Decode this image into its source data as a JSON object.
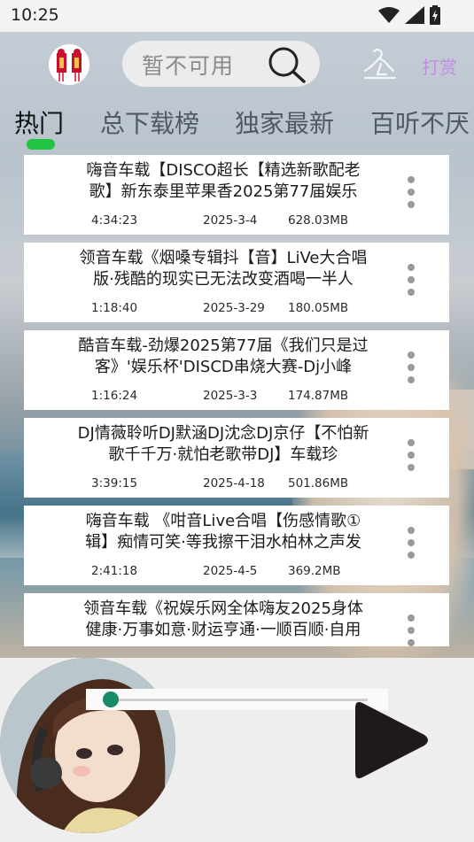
{
  "status_bar": {
    "time": "10:25"
  },
  "header": {
    "search_placeholder": "暂不可用",
    "reward_label": "打赏"
  },
  "tabs": [
    "热门",
    "总下载榜",
    "独家最新",
    "百听不厌"
  ],
  "active_tab_index": 0,
  "songs": [
    {
      "index": "0",
      "title": "嗨音车载【DISCO超长【精选新歌配老歌】新东泰里苹果香2025第77届娱乐",
      "duration": "4:34:23",
      "date": "2025-3-4",
      "size": "628.03MB"
    },
    {
      "index": "1",
      "title": "领音车载《烟嗓专辑抖【音】LiVe大合唱版·残酷的现实已无法改变酒喝一半人",
      "duration": "1:18:40",
      "date": "2025-3-29",
      "size": "180.05MB"
    },
    {
      "index": "2",
      "title": "酷音车载-劲爆2025第77届《我们只是过客》'娱乐杯'DISCD串烧大赛-Dj小峰",
      "duration": "1:16:24",
      "date": "2025-3-3",
      "size": "174.87MB"
    },
    {
      "index": "3",
      "title": "DJ情薇聆听DJ默涵DJ沈念DJ京仔【不怕新歌千千万·就怕老歌带DJ】车载珍",
      "duration": "3:39:15",
      "date": "2025-4-18",
      "size": "501.86MB"
    },
    {
      "index": "4",
      "title": "嗨音车载 《咁音Live合唱【伤感情歌①辑】痴情可笑·等我擦干泪水柏林之声发",
      "duration": "2:41:18",
      "date": "2025-4-5",
      "size": "369.2MB"
    },
    {
      "index": "5",
      "title": "领音车载《祝娱乐网全体嗨友2025身体健康·万事如意·财运亨通·一顺百顺·自用",
      "duration": "",
      "date": "",
      "size": ""
    }
  ],
  "player": {
    "progress_fraction": 0.02
  },
  "colors": {
    "tab_indicator": "#1fc441",
    "reward_text": "#c48be6",
    "progress_knob": "#1a8a6b"
  }
}
